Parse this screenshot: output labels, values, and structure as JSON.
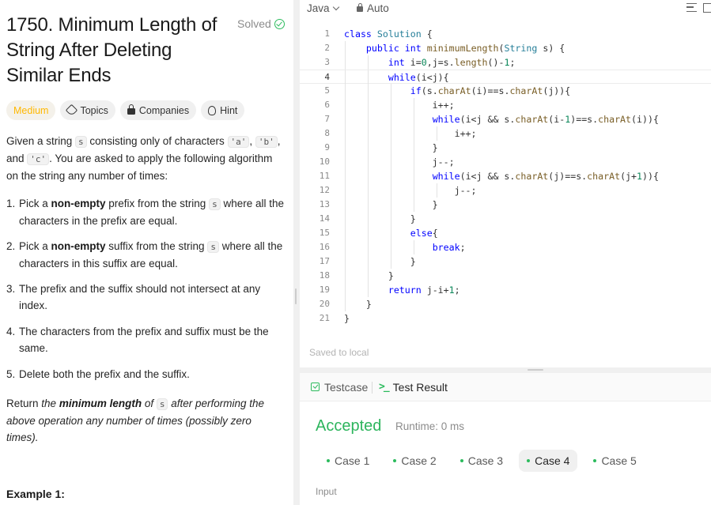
{
  "problem": {
    "title": "1750. Minimum Length of String After Deleting Similar Ends",
    "status": "Solved",
    "tags": {
      "difficulty": "Medium",
      "topics": "Topics",
      "companies": "Companies",
      "hint": "Hint"
    },
    "intro": {
      "p1": "Given a string ",
      "code_s": "s",
      "p2": " consisting only of characters ",
      "code_a": "'a'",
      "comma1": ", ",
      "code_b": "'b'",
      "comma2": ",",
      "and": "and ",
      "code_c": "'c'",
      "p3": ". You are asked to apply the following algorithm on the string any number of times:"
    },
    "steps": [
      {
        "num": "1.",
        "a": "Pick a ",
        "b": "non-empty",
        "c": " prefix from the string ",
        "code": "s",
        "d": " where all the characters in the prefix are equal."
      },
      {
        "num": "2.",
        "a": "Pick a ",
        "b": "non-empty",
        "c": " suffix from the string ",
        "code": "s",
        "d": " where all the characters in this suffix are equal."
      },
      {
        "num": "3.",
        "text": "The prefix and the suffix should not intersect at any index."
      },
      {
        "num": "4.",
        "text": "The characters from the prefix and suffix must be the same."
      },
      {
        "num": "5.",
        "text": "Delete both the prefix and the suffix."
      }
    ],
    "return_text": {
      "a": "Return ",
      "b": "the ",
      "c": "minimum length",
      "d": " of ",
      "code": "s",
      "e": " after performing the above operation any number of times (possibly zero times)."
    },
    "example_heading": "Example 1:"
  },
  "editor": {
    "language": "Java",
    "mode": "Auto",
    "saved_text": "Saved to local",
    "lines": [
      "1",
      "2",
      "3",
      "4",
      "5",
      "6",
      "7",
      "8",
      "9",
      "10",
      "11",
      "12",
      "13",
      "14",
      "15",
      "16",
      "17",
      "18",
      "19",
      "20",
      "21"
    ]
  },
  "result": {
    "tab_testcase": "Testcase",
    "tab_result": "Test Result",
    "status": "Accepted",
    "runtime": "Runtime: 0 ms",
    "cases": [
      "Case 1",
      "Case 2",
      "Case 3",
      "Case 4",
      "Case 5"
    ],
    "active_case": "Case 4",
    "input_label": "Input"
  },
  "colors": {
    "accent_green": "#2cbb5d",
    "medium": "#ffb800",
    "keyword": "#0000ff"
  }
}
